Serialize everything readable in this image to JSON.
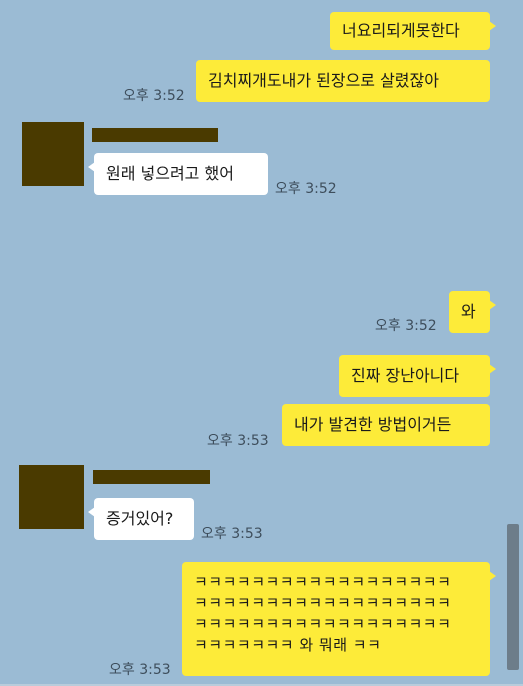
{
  "chat": {
    "messages": [
      {
        "sender": "me",
        "text": "너요리되게못한다"
      },
      {
        "sender": "me",
        "text": "김치찌개도내가 된장으로 살렸잖아",
        "time": "오후 3:52"
      },
      {
        "sender": "other",
        "text": "원래 넣으려고 했어",
        "time": "오후 3:52"
      },
      {
        "sender": "me",
        "text": "와",
        "time": "오후 3:52"
      },
      {
        "sender": "me",
        "text": "진짜 장난아니다"
      },
      {
        "sender": "me",
        "text": "내가 발견한 방법이거든",
        "time": "오후 3:53"
      },
      {
        "sender": "other",
        "text": "증거있어?",
        "time": "오후 3:53"
      },
      {
        "sender": "me",
        "lines": [
          "ㅋㅋㅋㅋㅋㅋㅋㅋㅋㅋㅋㅋㅋㅋㅋㅋㅋㅋ",
          "ㅋㅋㅋㅋㅋㅋㅋㅋㅋㅋㅋㅋㅋㅋㅋㅋㅋㅋ",
          "ㅋㅋㅋㅋㅋㅋㅋㅋㅋㅋㅋㅋㅋㅋㅋㅋㅋㅋ",
          "ㅋㅋㅋㅋㅋㅋㅋ 와 뭐래 ㅋㅋ"
        ],
        "time": "오후 3:53"
      }
    ]
  },
  "colors": {
    "background": "#9bbbd4",
    "my_bubble": "#fdeb39",
    "their_bubble": "#ffffff",
    "redaction": "#4a3a00"
  }
}
